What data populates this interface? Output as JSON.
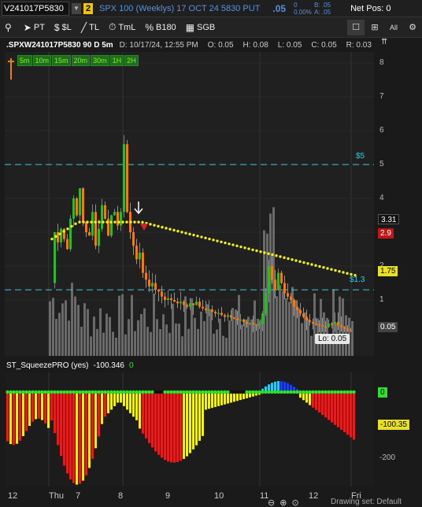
{
  "topbar": {
    "symbol": "V241017P5830",
    "link_badge": "2",
    "instrument": "SPX 100 (Weeklys) 17 OCT 24 5830 PUT",
    "last": ".05",
    "change": "0",
    "change_pct": "0.00%",
    "bid": "B: .05",
    "ask": "A: .05",
    "net_pos": "Net Pos: 0"
  },
  "toolbar": {
    "items": [
      {
        "icon": "pin-icon",
        "glyph": "⚲",
        "label": ""
      },
      {
        "icon": "pointer-icon",
        "glyph": "➤",
        "label": "PT"
      },
      {
        "icon": "dollar-level-icon",
        "glyph": "$",
        "label": "$L"
      },
      {
        "icon": "trendline-icon",
        "glyph": "╱",
        "label": "TL"
      },
      {
        "icon": "timeline-icon",
        "glyph": "⏱",
        "label": "TmL"
      },
      {
        "icon": "percent-icon",
        "glyph": "%",
        "label": "B180"
      },
      {
        "icon": "sgb-icon",
        "glyph": "▦",
        "label": "SGB"
      }
    ],
    "right_icons": [
      "single-layout-icon",
      "grid-layout-icon",
      "all-icon",
      "gear-icon"
    ],
    "all_label": "All"
  },
  "infobar": {
    "symbol": ".SPXW241017P5830 90 D 5m",
    "date": "D: 10/17/24, 12:55 PM",
    "open": "O: 0.05",
    "high": "H: 0.08",
    "low": "L: 0.05",
    "close": "C: 0.05",
    "range": "R: 0.03"
  },
  "timeframes": [
    "5m",
    "10m",
    "15m",
    "20m",
    "30m",
    "1H",
    "2H"
  ],
  "y_axis": {
    "ticks": [
      "8",
      "7",
      "6",
      "5",
      "4",
      "3",
      "2",
      "1"
    ],
    "tag_331": "3.31",
    "tag_29": "2.9",
    "tag_175": "1.75",
    "tag_005": "0.05"
  },
  "price_levels": {
    "line_5": "$5",
    "line_13": "$1.3"
  },
  "lo_label": "Lo: 0.05",
  "study": {
    "title": "ST_SqueezePRO (yes)",
    "value": "-100.346",
    "zero": "0",
    "ticks": [
      "0",
      "-100.35",
      "-200"
    ]
  },
  "x_axis": {
    "ticks": [
      "12",
      "Thu",
      "7",
      "8",
      "9",
      "10",
      "11",
      "12",
      "Fri"
    ]
  },
  "drawing_text": "Drawing set: Default",
  "colors": {
    "up_candle": "#2fb82f",
    "down_candle": "#f07a1a",
    "ema_dots": "#f0f020",
    "hline": "#3fc8d8",
    "hist_yellow": "#f0f020",
    "hist_red": "#e02020",
    "hist_cyan": "#30c8f0",
    "hist_blue": "#2040e0",
    "volume": "#6a6a6a"
  }
}
